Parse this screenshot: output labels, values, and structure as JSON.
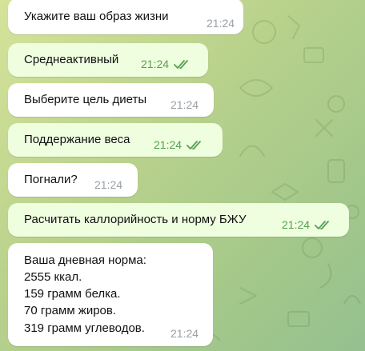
{
  "chat": {
    "messages": [
      {
        "side": "incoming",
        "text": "Укажите ваш образ жизни",
        "time": "21:24",
        "read": false
      },
      {
        "side": "outgoing",
        "text": "Среднеактивный",
        "time": "21:24",
        "read": true
      },
      {
        "side": "incoming",
        "text": "Выберите цель диеты",
        "time": "21:24",
        "read": false
      },
      {
        "side": "outgoing",
        "text": "Поддержание веса",
        "time": "21:24",
        "read": true
      },
      {
        "side": "incoming",
        "text": "Погнали?",
        "time": "21:24",
        "read": false
      },
      {
        "side": "outgoing",
        "text": "Расчитать каллорийность и норму БЖУ",
        "time": "21:24",
        "read": true
      },
      {
        "side": "incoming",
        "text_lines": [
          "Ваша дневная норма:",
          "2555 ккал.",
          "159 грамм белка.",
          "70 грамм жиров.",
          "319 грамм углеводов."
        ],
        "time": "21:24",
        "read": false
      }
    ]
  },
  "icons": {
    "read_receipt": "double-check-icon"
  },
  "colors": {
    "incoming_bubble": "#ffffff",
    "outgoing_bubble": "#eefedf",
    "read_check": "#57a04e",
    "timestamp_incoming": "#9aa0a6"
  }
}
